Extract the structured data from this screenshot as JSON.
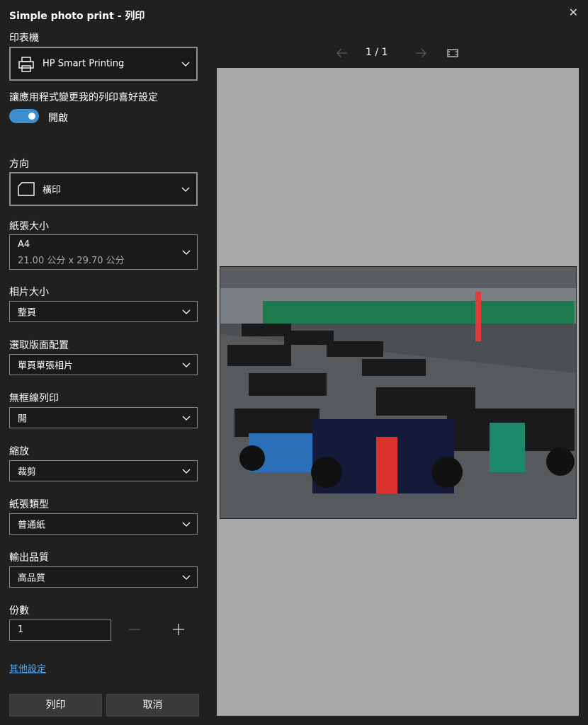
{
  "window": {
    "title": "Simple photo print - 列印"
  },
  "printer": {
    "label": "印表機",
    "value": "HP Smart Printing"
  },
  "app_pref": {
    "label": "讓應用程式變更我的列印喜好設定",
    "toggle_label": "開啟",
    "on": true
  },
  "orientation": {
    "label": "方向",
    "value": "橫印"
  },
  "paper_size": {
    "label": "紙張大小",
    "value": "A4",
    "detail": "21.00 公分 x 29.70 公分"
  },
  "photo_size": {
    "label": "相片大小",
    "value": "整頁"
  },
  "layout": {
    "label": "選取版面配置",
    "value": "單頁單張相片"
  },
  "borderless": {
    "label": "無框線列印",
    "value": "開"
  },
  "scale": {
    "label": "縮放",
    "value": "裁剪"
  },
  "paper_type": {
    "label": "紙張類型",
    "value": "普通紙"
  },
  "quality": {
    "label": "輸出品質",
    "value": "高品質"
  },
  "copies": {
    "label": "份數",
    "value": "1"
  },
  "more_settings": {
    "label": "其他設定"
  },
  "buttons": {
    "print": "列印",
    "cancel": "取消"
  },
  "preview": {
    "page_current": "1",
    "page_total": "1",
    "page_indicator": "1 / 1"
  },
  "colors": {
    "accent": "#3b8fd0",
    "link": "#5aa7ea",
    "background": "#202020",
    "preview_bg": "#a8a8a8"
  }
}
